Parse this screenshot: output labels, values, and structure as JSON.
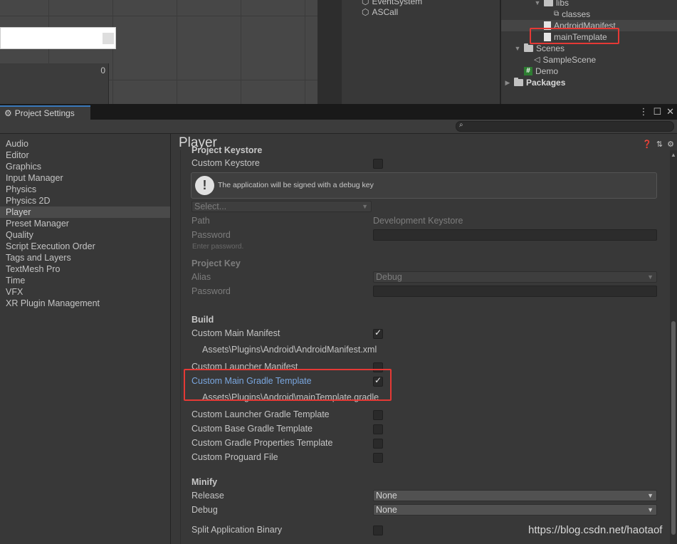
{
  "hierarchy": {
    "items": [
      "EventSystem",
      "ASCall"
    ]
  },
  "scene_view": {
    "value": "0"
  },
  "project_tree": {
    "libs": "libs",
    "classes": "classes",
    "android_manifest": "AndroidManifest",
    "main_template": "mainTemplate",
    "scenes": "Scenes",
    "sample_scene": "SampleScene",
    "demo": "Demo",
    "packages": "Packages"
  },
  "window": {
    "tab_title": "Project Settings",
    "controls": [
      "⋮",
      "☐",
      "✕"
    ]
  },
  "sidebar": {
    "items": [
      "Audio",
      "Editor",
      "Graphics",
      "Input Manager",
      "Physics",
      "Physics 2D",
      "Player",
      "Preset Manager",
      "Quality",
      "Script Execution Order",
      "Tags and Layers",
      "TextMesh Pro",
      "Time",
      "VFX",
      "XR Plugin Management"
    ],
    "selected": "Player"
  },
  "main": {
    "title": "Player",
    "keystore_section": "Project Keystore",
    "custom_keystore": "Custom Keystore",
    "debug_key_message": "The application will be signed with a debug key",
    "select_placeholder": "Select...",
    "path_label": "Path",
    "path_value": "Development Keystore",
    "password_label": "Password",
    "password_hint": "Enter password.",
    "project_key": "Project Key",
    "alias_label": "Alias",
    "alias_value": "Debug",
    "password2_label": "Password",
    "build_header": "Build",
    "custom_main_manifest": "Custom Main Manifest",
    "manifest_path": "Assets\\Plugins\\Android\\AndroidManifest.xml",
    "custom_launcher_manifest": "Custom Launcher Manifest",
    "custom_main_gradle": "Custom Main Gradle Template",
    "gradle_path": "Assets\\Plugins\\Android\\mainTemplate.gradle",
    "custom_launcher_gradle": "Custom Launcher Gradle Template",
    "custom_base_gradle": "Custom Base Gradle Template",
    "custom_gradle_props": "Custom Gradle Properties Template",
    "custom_proguard": "Custom Proguard File",
    "minify_header": "Minify",
    "release_label": "Release",
    "release_value": "None",
    "debug_label": "Debug",
    "debug_value": "None",
    "split_binary": "Split Application Binary"
  },
  "watermark": "https://blog.csdn.net/haotaof"
}
